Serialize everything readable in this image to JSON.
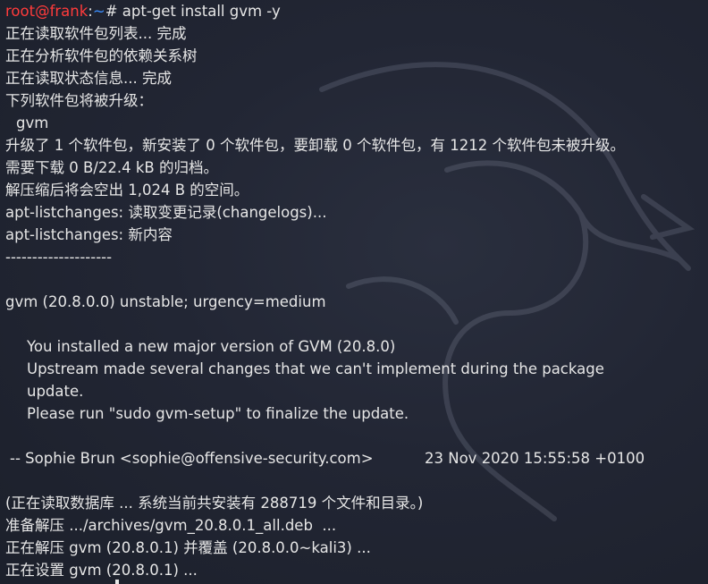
{
  "prompt": {
    "user_host": "root@frank",
    "separator": ":",
    "path": "~",
    "symbol": "# ",
    "command": "apt-get install gvm -y"
  },
  "output": {
    "reading_package_lists": "正在读取软件包列表... 完成",
    "building_dependency_tree": "正在分析软件包的依赖关系树",
    "reading_state_info": "正在读取状态信息... 完成",
    "upgrade_header": "下列软件包将被升级：",
    "package_name": "gvm",
    "upgrade_summary": "升级了 1 个软件包，新安装了 0 个软件包，要卸载 0 个软件包，有 1212 个软件包未被升级。",
    "download_size": "需要下载 0 B/22.4 kB 的归档。",
    "disk_space": "解压缩后将会空出 1,024 B 的空间。",
    "listchanges_reading": "apt-listchanges: 读取变更记录(changelogs)...",
    "listchanges_news": "apt-listchanges: 新内容",
    "divider": "--------------------",
    "changelog_header": "gvm (20.8.0.0) unstable; urgency=medium",
    "news_line1": "You installed a new major version of GVM (20.8.0)",
    "news_line2": "Upstream made several changes that we can't implement during the package",
    "news_line3": "update.",
    "news_line4": "Please run \"sudo gvm-setup\" to finalize the update.",
    "maintainer": "-- Sophie Brun <sophie@offensive-security.com>",
    "maintainer_date": "23 Nov 2020 15:55:58 +0100",
    "reading_database": "(正在读取数据库 ... 系统当前共安装有 288719 个文件和目录。)",
    "preparing_unpack": "准备解压 .../archives/gvm_20.8.0.1_all.deb  ...",
    "unpacking": "正在解压 gvm (20.8.0.1) 并覆盖 (20.8.0.0~kali3) ...",
    "setting_up": "正在设置 gvm (20.8.0.1) ..."
  },
  "theme": {
    "background": "#222634",
    "text": "#e6e6e6",
    "prompt_user": "#ff3b3b",
    "prompt_path": "#3b8eff"
  },
  "icons": {
    "watermark": "kali-dragon-icon"
  }
}
